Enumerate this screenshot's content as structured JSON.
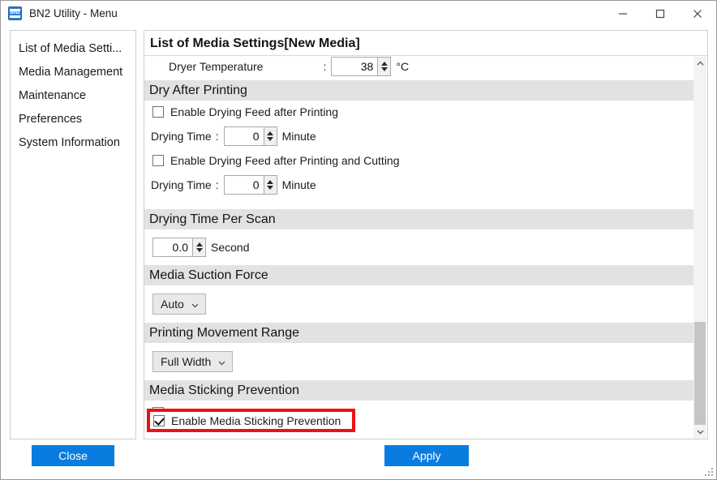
{
  "window": {
    "title": "BN2 Utility - Menu",
    "icon": "app-icon",
    "icon_text": "BN2",
    "controls": {
      "minimize": "minimize-icon",
      "maximize": "maximize-icon",
      "close": "close-icon"
    }
  },
  "sidebar": {
    "items": [
      {
        "label": "List of Media Setti..."
      },
      {
        "label": "Media Management"
      },
      {
        "label": "Maintenance"
      },
      {
        "label": "Preferences"
      },
      {
        "label": "System Information"
      }
    ]
  },
  "main": {
    "title": "List of Media Settings[New Media]",
    "rows": {
      "dryer_temperature": {
        "label": "Dryer Temperature",
        "colon": ":",
        "value": "38",
        "unit": "°C"
      },
      "dry_after_printing": {
        "section": "Dry After Printing",
        "checkbox1": {
          "label": "Enable Drying Feed after Printing",
          "checked": false
        },
        "drying_time1": {
          "label": "Drying Time",
          "colon": ":",
          "value": "0",
          "unit": "Minute"
        },
        "checkbox2": {
          "label": "Enable Drying Feed after Printing and Cutting",
          "checked": false
        },
        "drying_time2": {
          "label": "Drying Time",
          "colon": ":",
          "value": "0",
          "unit": "Minute"
        }
      },
      "drying_time_per_scan": {
        "section": "Drying Time Per Scan",
        "value": "0.0",
        "unit": "Second"
      },
      "media_suction_force": {
        "section": "Media Suction Force",
        "selected": "Auto"
      },
      "printing_movement_range": {
        "section": "Printing Movement Range",
        "selected": "Full Width"
      },
      "media_sticking_prevention": {
        "section": "Media Sticking Prevention",
        "checkbox": {
          "label": "Enable Media Sticking Prevention",
          "checked": true
        }
      }
    }
  },
  "footer": {
    "close_label": "Close",
    "apply_label": "Apply"
  },
  "colors": {
    "accent": "#0a7ce0",
    "section_band": "#e2e2e2",
    "highlight": "#ee1111",
    "scrollbar_thumb": "#c5c5c5"
  }
}
